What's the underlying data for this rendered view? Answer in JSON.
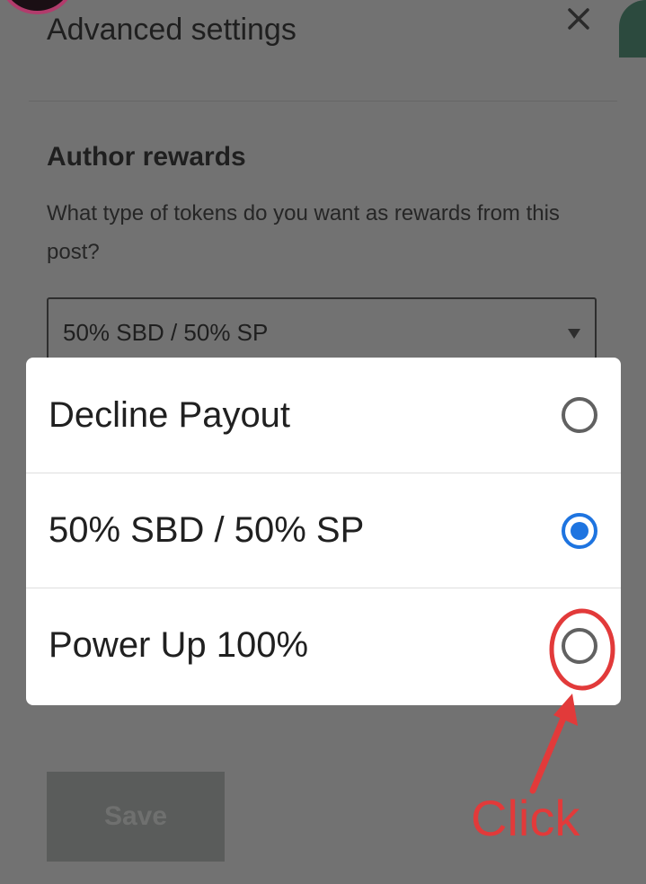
{
  "header": {
    "title": "Advanced settings",
    "close_icon": "close-icon"
  },
  "author_rewards": {
    "title": "Author rewards",
    "description": "What type of tokens do you want as rewards from this post?",
    "select_value": "50% SBD / 50% SP"
  },
  "footer": {
    "save_label": "Save"
  },
  "dialog": {
    "options": [
      {
        "label": "Decline Payout",
        "selected": false
      },
      {
        "label": "50% SBD / 50% SP",
        "selected": true
      },
      {
        "label": "Power Up 100%",
        "selected": false
      }
    ]
  },
  "annotation": {
    "text": "Click",
    "color": "#e23a3a"
  },
  "colors": {
    "radio_selected": "#1e74e0",
    "overlay": "#727272"
  }
}
